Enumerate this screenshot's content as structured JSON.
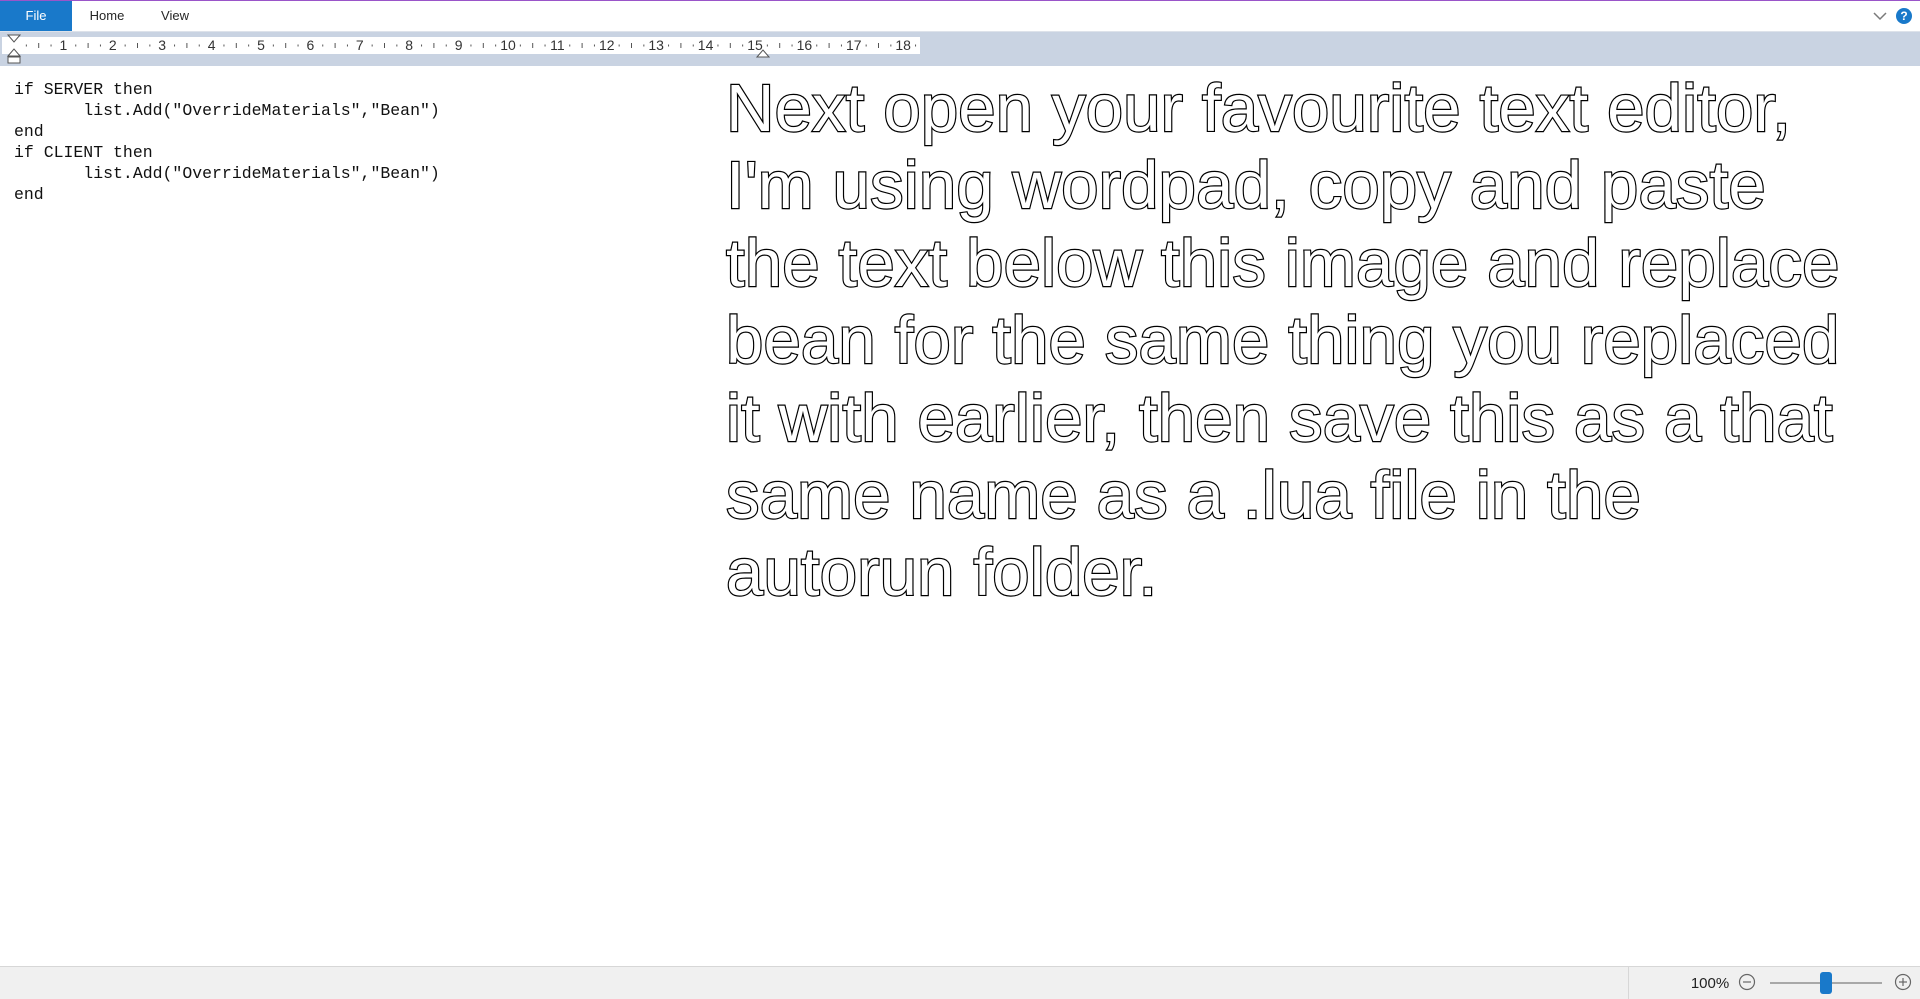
{
  "ribbon": {
    "tabs": [
      "File",
      "Home",
      "View"
    ],
    "help_label": "?"
  },
  "ruler": {
    "numbers": [
      "1",
      "2",
      "3",
      "4",
      "5",
      "6",
      "7",
      "8",
      "9",
      "10",
      "11",
      "12",
      "13",
      "14",
      "15",
      "16",
      "17",
      "18"
    ]
  },
  "document": {
    "code_lines": [
      "if SERVER then",
      "       list.Add(\"OverrideMaterials\",\"Bean\")",
      "end",
      "if CLIENT then",
      "       list.Add(\"OverrideMaterials\",\"Bean\")",
      "end"
    ],
    "annotation_lines": [
      "Next open your favourite text editor,",
      "I'm using wordpad, copy and paste",
      "the text below this image and replace",
      "bean for the same thing you replaced",
      "it with earlier, then save this as a that",
      "same name as a .lua file in the",
      "autorun folder."
    ]
  },
  "statusbar": {
    "zoom": "100%",
    "zoom_percent": 100
  },
  "colors": {
    "accent": "#1979ca",
    "ruler_band": "#c9d3e2"
  }
}
